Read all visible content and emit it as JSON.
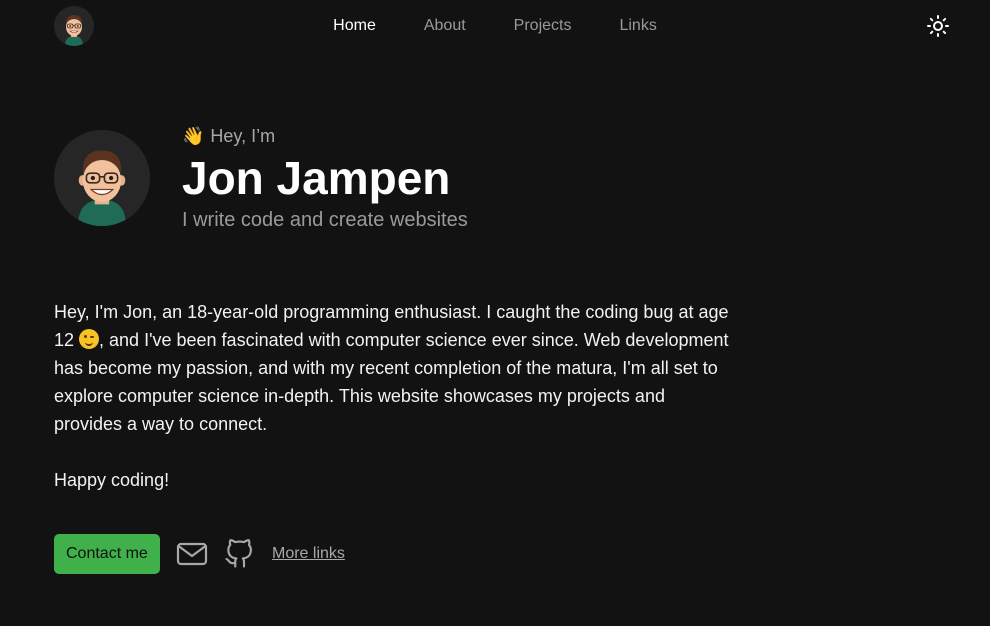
{
  "nav": {
    "items": [
      {
        "label": "Home",
        "active": true
      },
      {
        "label": "About",
        "active": false
      },
      {
        "label": "Projects",
        "active": false
      },
      {
        "label": "Links",
        "active": false
      }
    ],
    "avatar_icon": "avatar-memoji-icon",
    "theme_icon": "sun-icon"
  },
  "hero": {
    "greeting_emoji": "👋",
    "greeting": "Hey, I’m",
    "name": "Jon Jampen",
    "tagline": "I write code and create websites"
  },
  "bio": {
    "p1_a": "Hey, I'm Jon, an 18-year-old programming enthusiast. I caught the coding bug at age 12 ",
    "p1_b": ", and I've been fascinated with computer science ever since. Web development has become my passion, and with my recent completion of the matura, I'm all set to explore computer science in-depth. This website showcases my projects and provides a way to connect.",
    "p2": "Happy coding!"
  },
  "actions": {
    "contact_label": "Contact me",
    "more_links_label": "More links",
    "mail_icon": "mail-icon",
    "github_icon": "github-icon"
  },
  "colors": {
    "background": "#121212",
    "accent_green": "#3fb04a",
    "muted_text": "#9a9a9a"
  }
}
